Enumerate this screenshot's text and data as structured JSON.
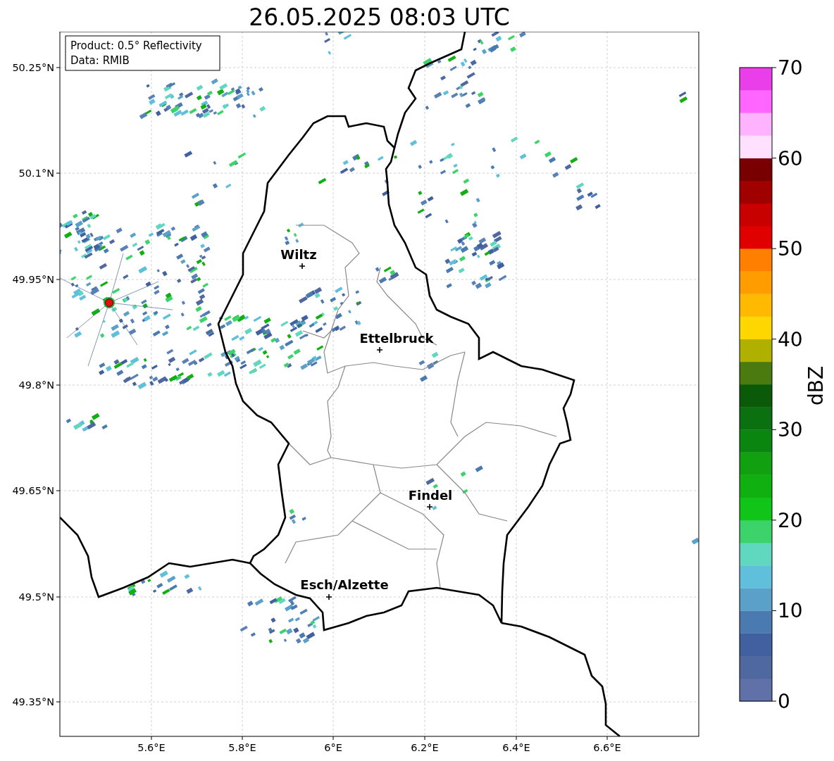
{
  "title": "26.05.2025 08:03 UTC",
  "info_box": {
    "lines": [
      "Product: 0.5° Reflectivity",
      "Data: RMIB"
    ]
  },
  "map": {
    "x_ticks": [
      "5.6°E",
      "5.8°E",
      "6°E",
      "6.2°E",
      "6.4°E",
      "6.6°E"
    ],
    "y_ticks": [
      "50.25°N",
      "50.1°N",
      "49.95°N",
      "49.8°N",
      "49.65°N",
      "49.5°N",
      "49.35°N"
    ],
    "cities": [
      {
        "name": "Wiltz"
      },
      {
        "name": "Ettelbruck"
      },
      {
        "name": "Findel"
      },
      {
        "name": "Esch/Alzette"
      }
    ]
  },
  "colorbar": {
    "label": "dBZ",
    "ticks": [
      "70",
      "60",
      "50",
      "40",
      "30",
      "20",
      "10",
      "0"
    ],
    "bins": [
      {
        "color": "#6070a8"
      },
      {
        "color": "#5068a0"
      },
      {
        "color": "#4060a0"
      },
      {
        "color": "#4a7ab0"
      },
      {
        "color": "#5aa0c8"
      },
      {
        "color": "#60c0dc"
      },
      {
        "color": "#60d8c0"
      },
      {
        "color": "#3cd46a"
      },
      {
        "color": "#10c518"
      },
      {
        "color": "#10b010"
      },
      {
        "color": "#10a010"
      },
      {
        "color": "#0a8510"
      },
      {
        "color": "#0a7010"
      },
      {
        "color": "#0a5a0a"
      },
      {
        "color": "#4a7a10"
      },
      {
        "color": "#b0b000"
      },
      {
        "color": "#ffd700"
      },
      {
        "color": "#ffb900"
      },
      {
        "color": "#ff9c00"
      },
      {
        "color": "#ff7f00"
      },
      {
        "color": "#e00000"
      },
      {
        "color": "#c80000"
      },
      {
        "color": "#a00000"
      },
      {
        "color": "#780000"
      },
      {
        "color": "#ffe0ff"
      },
      {
        "color": "#ffb3ff"
      },
      {
        "color": "#ff66ff"
      },
      {
        "color": "#e93ee9"
      }
    ]
  }
}
